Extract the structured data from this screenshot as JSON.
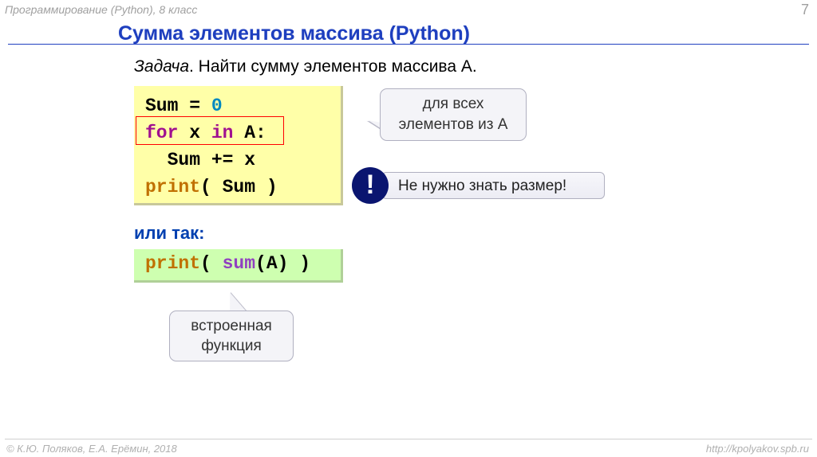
{
  "header": {
    "left": "Программирование (Python), 8 класс",
    "page": "7"
  },
  "title": "Сумма элементов массива (Python)",
  "task": {
    "label": "Задача",
    "text": ". Найти сумму элементов массива A."
  },
  "code1": {
    "l1_a": "Sum = ",
    "l1_b": "0",
    "l2_a": "for",
    "l2_b": " x ",
    "l2_c": "in",
    "l2_d": " A:",
    "l3": "  Sum += x",
    "l4_a": "print",
    "l4_b": "( Sum )"
  },
  "callout1": {
    "line1": "для всех",
    "line2": "элементов из A"
  },
  "bang": "!",
  "callout2": "Не нужно знать размер!",
  "ortak": "или так:",
  "code2": {
    "a": "print",
    "b": "( ",
    "c": "sum",
    "d": "(A) )"
  },
  "callout3": {
    "line1": "встроенная",
    "line2": "функция"
  },
  "footer": {
    "left": "© К.Ю. Поляков, Е.А. Ерёмин, 2018",
    "right": "http://kpolyakov.spb.ru"
  }
}
